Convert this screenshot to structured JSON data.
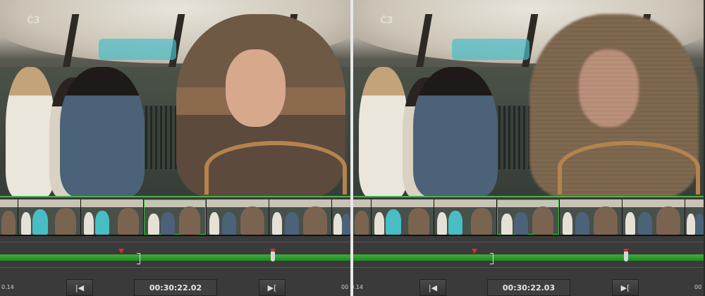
{
  "left_viewer": {
    "logo_text": "Č3",
    "timecode": "00:30:22.02",
    "edge_left_label": "0.14",
    "edge_right_label": "00",
    "prev_button_icon": "step-back-icon",
    "next_button_icon": "step-forward-icon",
    "prev_glyph": "|◀",
    "next_glyph": "▶["
  },
  "right_viewer": {
    "logo_text": "Č3",
    "timecode": "00:30:22.03",
    "edge_left_label": "00.14",
    "edge_right_label": "00",
    "prev_button_icon": "step-back-icon",
    "next_button_icon": "step-forward-icon",
    "prev_glyph": "|◀",
    "next_glyph": "▶["
  },
  "colors": {
    "timeline_green": "#2fa02f",
    "marker_red": "#e02a2a",
    "selected_thumb_outline": "#34c534",
    "divider": "#e8e8e8"
  }
}
